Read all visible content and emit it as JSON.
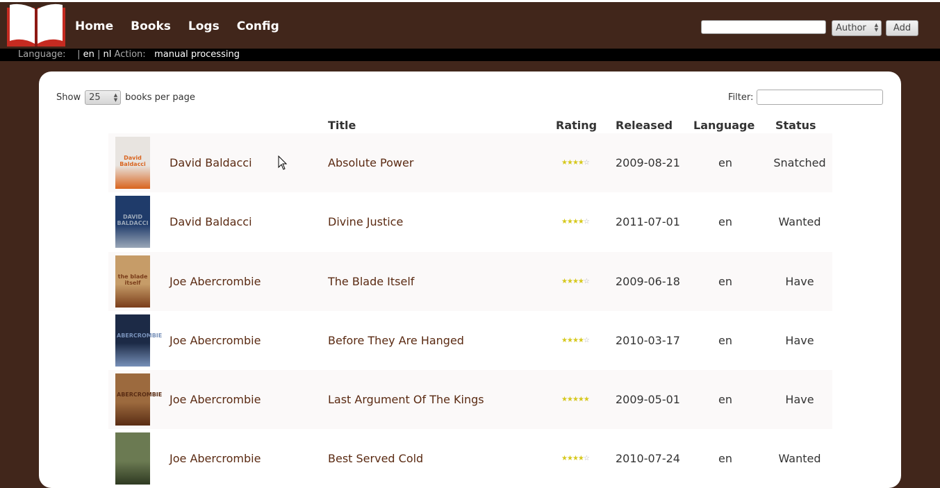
{
  "nav": {
    "home": "Home",
    "books": "Books",
    "logs": "Logs",
    "config": "Config"
  },
  "search": {
    "value": "",
    "type_selected": "Author",
    "add_label": "Add"
  },
  "subbar": {
    "language_label": "Language:",
    "sep1": "|",
    "lang_en": "en",
    "sep2": "|",
    "lang_nl": "nl",
    "action_label": "Action:",
    "action_value": "manual processing"
  },
  "table_controls": {
    "show_label": "Show",
    "per_page_value": "25",
    "per_page_suffix": "books per page",
    "filter_label": "Filter:",
    "filter_value": ""
  },
  "columns": [
    "Title",
    "Rating",
    "Released",
    "Language",
    "Status"
  ],
  "books": [
    {
      "author": "David Baldacci",
      "title": "Absolute Power",
      "rating": 4,
      "released": "2009-08-21",
      "language": "en",
      "status": "Snatched",
      "cover_color": "#e8e4e0",
      "cover_accent": "#d9641e",
      "cover_text": "David Baldacci"
    },
    {
      "author": "David Baldacci",
      "title": "Divine Justice",
      "rating": 4,
      "released": "2011-07-01",
      "language": "en",
      "status": "Wanted",
      "cover_color": "#1f3b6a",
      "cover_accent": "#9aa7b8",
      "cover_text": "DAVID BALDACCI"
    },
    {
      "author": "Joe Abercrombie",
      "title": "The Blade Itself",
      "rating": 4,
      "released": "2009-06-18",
      "language": "en",
      "status": "Have",
      "cover_color": "#c69c68",
      "cover_accent": "#7a3d1a",
      "cover_text": "the blade itself"
    },
    {
      "author": "Joe Abercrombie",
      "title": "Before They Are Hanged",
      "rating": 4,
      "released": "2010-03-17",
      "language": "en",
      "status": "Have",
      "cover_color": "#1c2a46",
      "cover_accent": "#7790b8",
      "cover_text": "ABERCROMBIE"
    },
    {
      "author": "Joe Abercrombie",
      "title": "Last Argument Of The Kings",
      "rating": 5,
      "released": "2009-05-01",
      "language": "en",
      "status": "Have",
      "cover_color": "#9c6a3e",
      "cover_accent": "#5a2d14",
      "cover_text": "ABERCROMBIE"
    },
    {
      "author": "Joe Abercrombie",
      "title": "Best Served Cold",
      "rating": 4,
      "released": "2010-07-24",
      "language": "en",
      "status": "Wanted",
      "cover_color": "#6b7a52",
      "cover_accent": "#2f3a22",
      "cover_text": ""
    }
  ],
  "colors": {
    "header_bg": "#41261b",
    "link": "#5a2a12",
    "star_on": "#d6c81d"
  }
}
